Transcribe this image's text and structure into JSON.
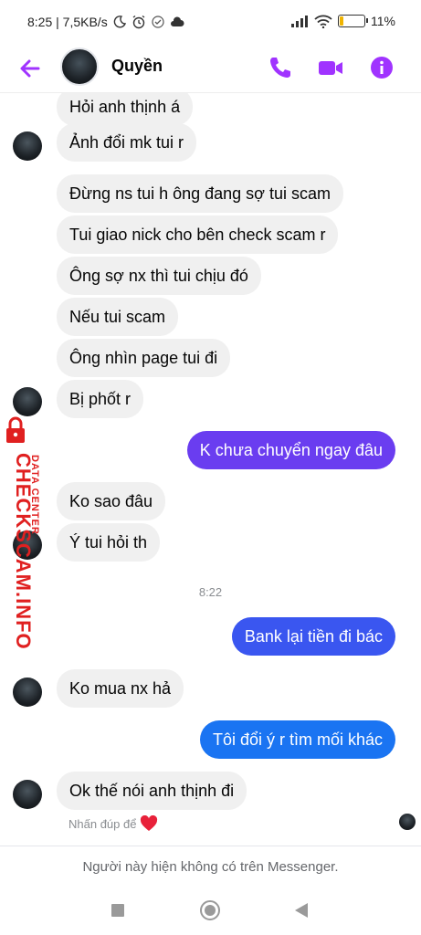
{
  "status_bar": {
    "left": "8:25 | 7,5KB/s",
    "battery_text": "11",
    "battery_level": 0.11
  },
  "header": {
    "contact_name": "Quyền"
  },
  "colors": {
    "accent": "#a033ff",
    "outgoing_1": "#6a3df0",
    "outgoing_2": "#2f5ff0",
    "outgoing_3": "#1a74f2",
    "incoming": "#f0f0f0"
  },
  "icons": [
    "back-arrow-icon",
    "phone-icon",
    "video-icon",
    "info-icon",
    "heart-icon",
    "stop-icon",
    "home-icon",
    "back-triangle-icon"
  ],
  "messages": [
    {
      "text": "Hỏi anh thịnh á"
    },
    {
      "text": "Ảnh đổi mk tui r"
    },
    {
      "text": "Đừng ns tui h ông đang sợ tui scam"
    },
    {
      "text": "Tui giao nick cho bên check scam r"
    },
    {
      "text": "Ông sợ nx thì tui chịu đó"
    },
    {
      "text": "Nếu tui scam"
    },
    {
      "text": "Ông nhìn page tui đi"
    },
    {
      "text": "Bị phốt r"
    },
    {
      "text": "K chưa chuyển ngay đâu"
    },
    {
      "text": "Ko sao đâu"
    },
    {
      "text": "Ý tui hỏi th"
    },
    {
      "text": "Bank lại tiền đi bác"
    },
    {
      "text": "Ko mua nx hả"
    },
    {
      "text": "Tôi đổi ý r tìm mối khác"
    },
    {
      "text": "Ok thế nói anh thịnh đi"
    }
  ],
  "time_separator": "8:22",
  "reaction_hint": "Nhấn đúp để",
  "watermark": {
    "main": "CHECKSCAM.INFO",
    "sub": "DATA CENTER"
  },
  "footer_text": "Người này hiện không có trên Messenger."
}
